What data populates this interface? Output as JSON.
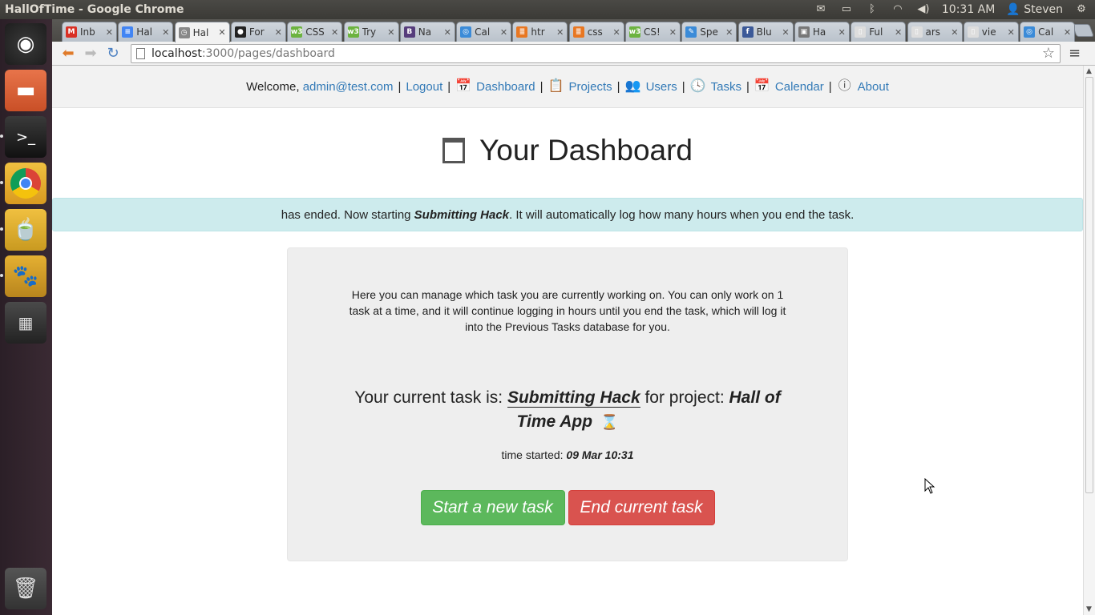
{
  "os": {
    "window_title": "HallOfTime - Google Chrome",
    "clock": "10:31 AM",
    "user": "Steven"
  },
  "browser": {
    "tabs": [
      {
        "label": "Inb",
        "fav": "M",
        "color": "#d93025"
      },
      {
        "label": "Hal",
        "fav": "≡",
        "color": "#4285f4"
      },
      {
        "label": "Hal",
        "fav": "◷",
        "color": "#888888",
        "active": true
      },
      {
        "label": "For",
        "fav": "●",
        "color": "#222222"
      },
      {
        "label": "CSS",
        "fav": "w3",
        "color": "#6cb33f"
      },
      {
        "label": "Try",
        "fav": "w3",
        "color": "#6cb33f"
      },
      {
        "label": "Na",
        "fav": "B",
        "color": "#563d7c"
      },
      {
        "label": "Cal",
        "fav": "◎",
        "color": "#3b8bd8"
      },
      {
        "label": "htr",
        "fav": "≣",
        "color": "#e87722"
      },
      {
        "label": "css",
        "fav": "≣",
        "color": "#e87722"
      },
      {
        "label": "CS!",
        "fav": "w3",
        "color": "#6cb33f"
      },
      {
        "label": "Spe",
        "fav": "✎",
        "color": "#3b8bd8"
      },
      {
        "label": "Blu",
        "fav": "f",
        "color": "#3b5998"
      },
      {
        "label": "Ha",
        "fav": "▣",
        "color": "#777777"
      },
      {
        "label": "Ful",
        "fav": "▯",
        "color": "#dddddd"
      },
      {
        "label": "ars",
        "fav": "▯",
        "color": "#dddddd"
      },
      {
        "label": "vie",
        "fav": "▯",
        "color": "#dddddd"
      },
      {
        "label": "Cal",
        "fav": "◎",
        "color": "#3b8bd8"
      }
    ],
    "url_host": "localhost",
    "url_path": ":3000/pages/dashboard"
  },
  "nav": {
    "welcome": "Welcome,",
    "user_email": "admin@test.com",
    "logout": "Logout",
    "dashboard": "Dashboard",
    "projects": "Projects",
    "users": "Users",
    "tasks": "Tasks",
    "calendar": "Calendar",
    "about": "About",
    "sep": "|"
  },
  "page": {
    "title": "Your Dashboard",
    "alert_prefix": "has ended. Now starting ",
    "alert_task": "Submitting Hack",
    "alert_suffix": ". It will automatically log how many hours when you end the task.",
    "intro": "Here you can manage which task you are currently working on. You can only work on 1 task at a time, and it will continue logging in hours until you end the task, which will log it into the Previous Tasks database for you.",
    "current_prefix": "Your current task is: ",
    "current_task": "Submitting Hack",
    "project_prefix": " for project: ",
    "current_project": "Hall of Time App",
    "started_label": "time started: ",
    "started_value": "09 Mar 10:31",
    "start_button": "Start a new task",
    "end_button": "End current task"
  }
}
